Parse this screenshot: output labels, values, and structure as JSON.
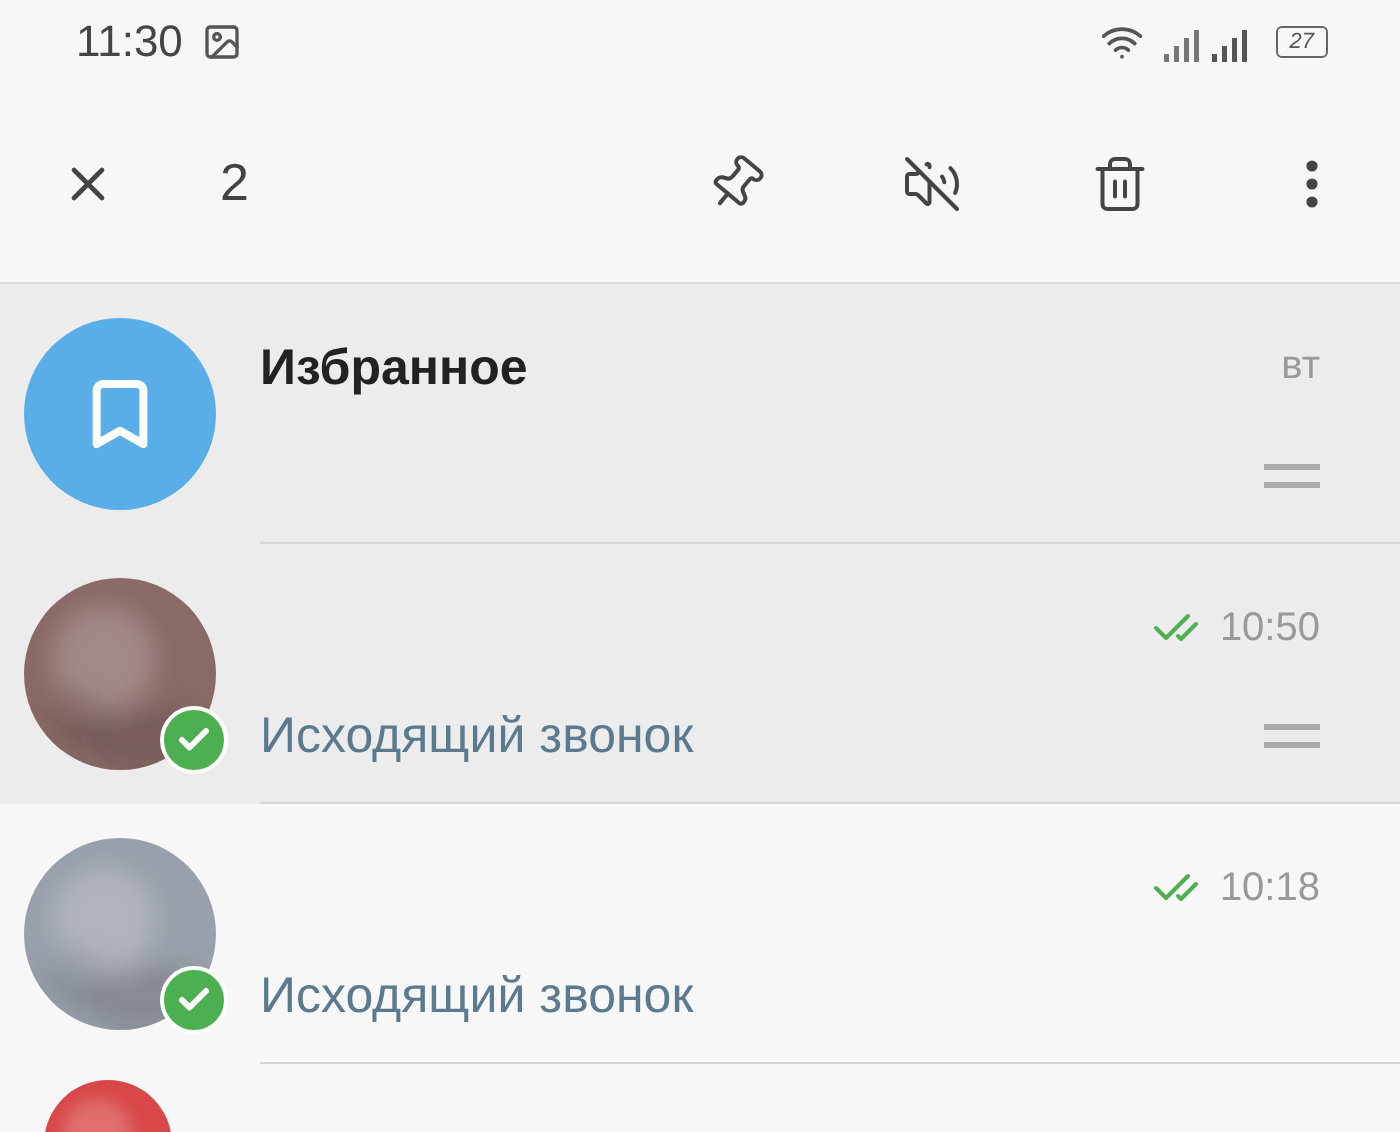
{
  "status_bar": {
    "time": "11:30",
    "battery": "27"
  },
  "toolbar": {
    "selected_count": "2"
  },
  "chats": [
    {
      "avatar": {
        "kind": "saved"
      },
      "title": "Избранное",
      "time": "вт",
      "pinned": true,
      "selected": false
    },
    {
      "time": "10:50",
      "message": "Исходящий звонок",
      "read": true,
      "pinned": true,
      "selected": true
    },
    {
      "time": "10:18",
      "message": "Исходящий звонок",
      "read": true,
      "pinned": false,
      "selected": true
    }
  ]
}
